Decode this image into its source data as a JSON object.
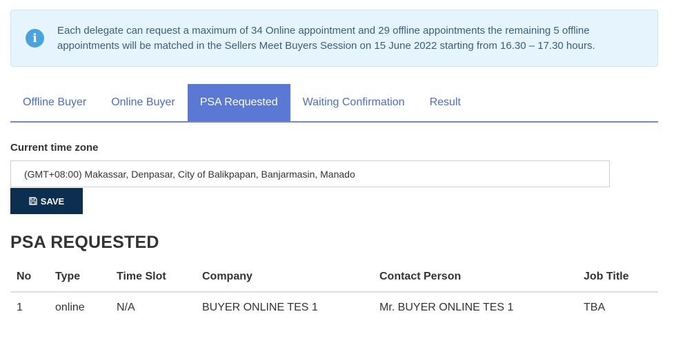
{
  "alert": {
    "icon": "info-icon",
    "text": "Each delegate can request a maximum of 34 Online appointment and 29 offline appointments the remaining 5 offline appointments will be matched in the Sellers Meet Buyers Session on 15 June 2022 starting from 16.30 – 17.30 hours."
  },
  "tabs": [
    {
      "label": "Offline Buyer",
      "active": false
    },
    {
      "label": "Online Buyer",
      "active": false
    },
    {
      "label": "PSA Requested",
      "active": true
    },
    {
      "label": "Waiting Confirmation",
      "active": false
    },
    {
      "label": "Result",
      "active": false
    }
  ],
  "timezone": {
    "label": "Current time zone",
    "selected": "(GMT+08:00) Makassar, Denpasar, City of Balikpapan, Banjarmasin, Manado"
  },
  "save_button": {
    "label": "SAVE",
    "icon": "floppy-disk-icon"
  },
  "section": {
    "title": "PSA REQUESTED"
  },
  "table": {
    "headers": [
      "No",
      "Type",
      "Time Slot",
      "Company",
      "Contact Person",
      "Job Title"
    ],
    "rows": [
      [
        "1",
        "online",
        "N/A",
        "BUYER ONLINE TES 1",
        "Mr. BUYER ONLINE TES 1",
        "TBA"
      ]
    ]
  },
  "colors": {
    "alert_bg": "#e5f4fd",
    "tab_active_bg": "#5b78d4",
    "tab_link": "#4a6ec4",
    "save_bg": "#0c2f4f"
  }
}
